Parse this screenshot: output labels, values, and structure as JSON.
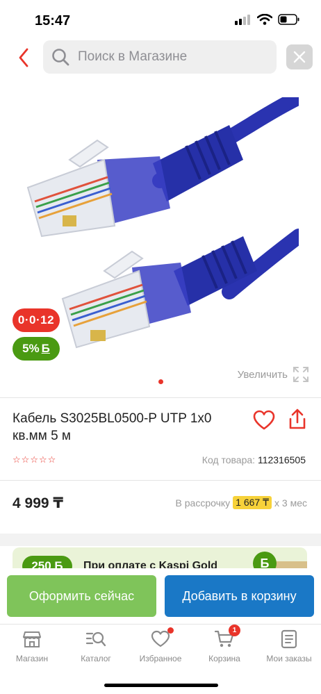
{
  "status_bar": {
    "time": "15:47"
  },
  "search": {
    "placeholder": "Поиск в Магазине"
  },
  "product": {
    "badges": {
      "timer": "0·0·12",
      "bonus_percent": "5%",
      "bonus_symbol": "Б"
    },
    "zoom_label": "Увеличить",
    "title": "Кабель S3025BL0500-P UTP 1x0 кв.мм 5 м",
    "rating": 0,
    "code_label": "Код товара:",
    "code_value": "112316505",
    "price": "4 999 ₸",
    "installment": {
      "prefix": "В рассрочку",
      "amount": "1 667 ₸",
      "suffix": "x 3 мес"
    }
  },
  "kaspi_banner": {
    "bonus": "250 Б",
    "text": "При оплате с Kaspi Gold",
    "coin": "Б"
  },
  "actions": {
    "order_now": "Оформить сейчас",
    "add_to_cart": "Добавить в корзину"
  },
  "tabs": [
    {
      "label": "Магазин",
      "icon": "store-icon"
    },
    {
      "label": "Каталог",
      "icon": "catalog-search-icon"
    },
    {
      "label": "Избранное",
      "icon": "heart-icon"
    },
    {
      "label": "Корзина",
      "icon": "cart-icon",
      "count": "1"
    },
    {
      "label": "Мои заказы",
      "icon": "orders-icon"
    }
  ],
  "colors": {
    "accent_red": "#e9342a",
    "bonus_green": "#4a9a12",
    "primary_blue": "#1a78c6",
    "order_green": "#7fc45a",
    "installment_yellow": "#f7d23a"
  }
}
